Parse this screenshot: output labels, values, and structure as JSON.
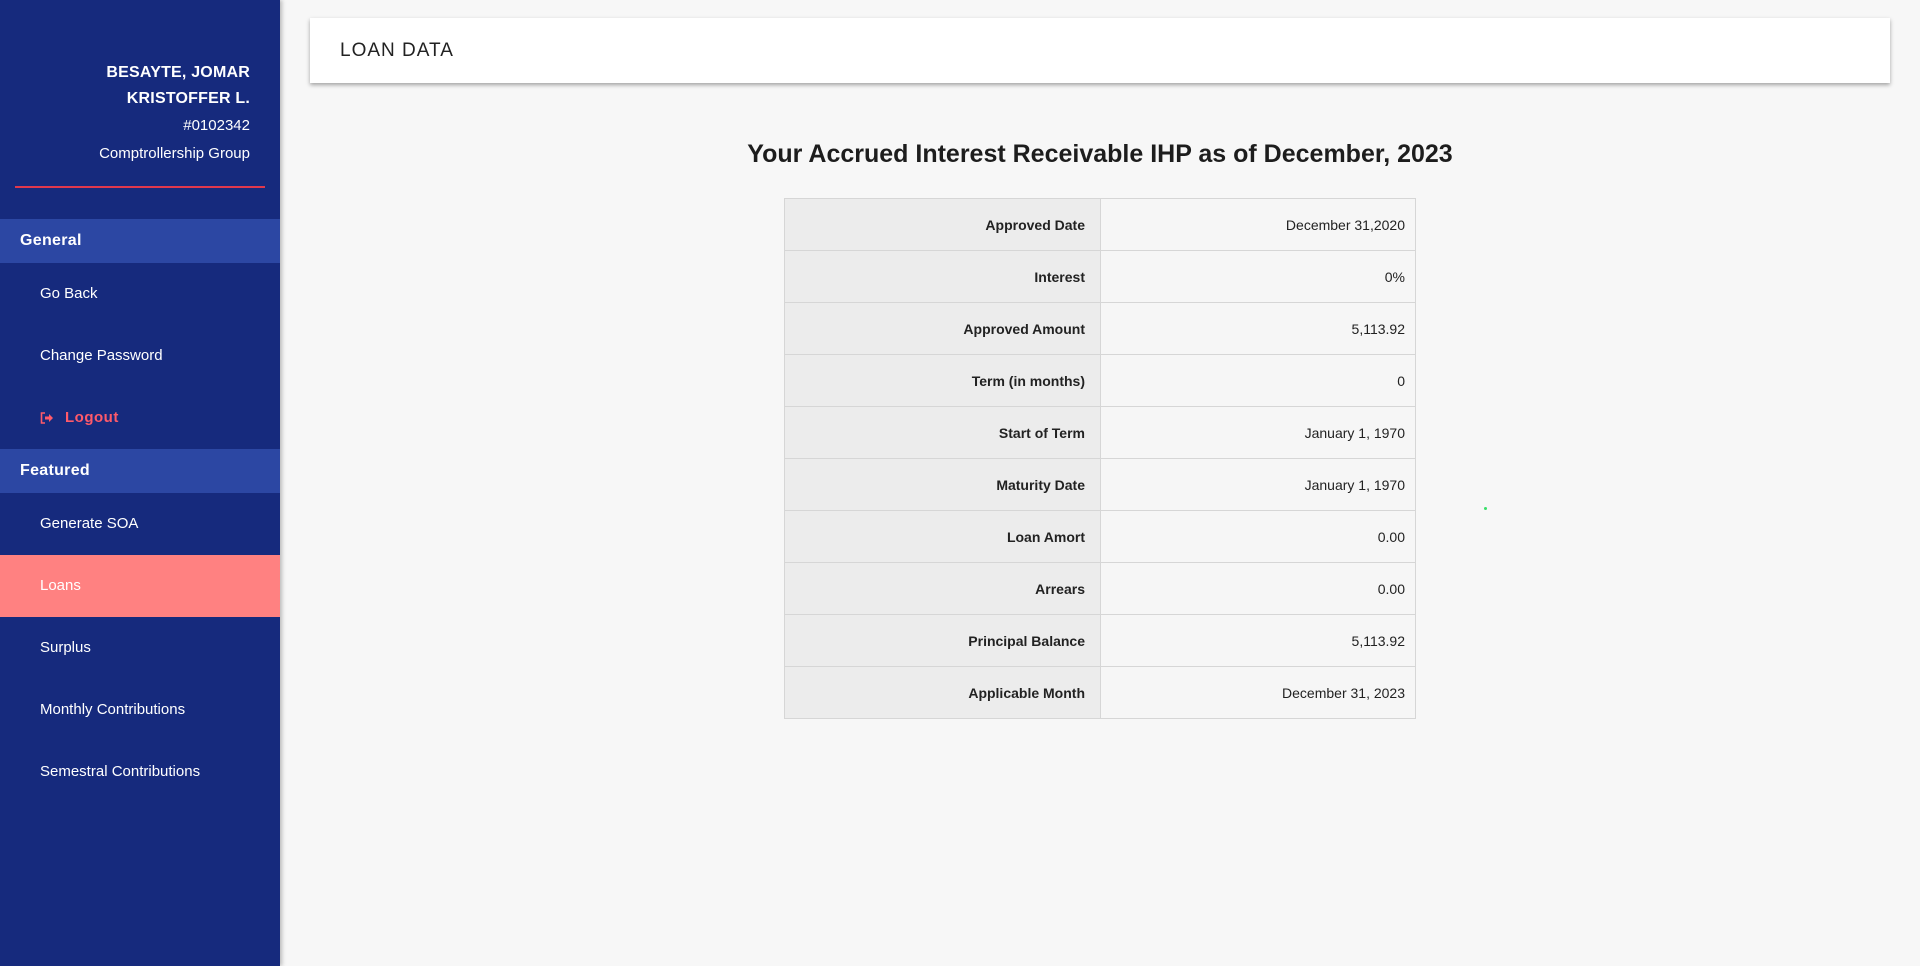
{
  "profile": {
    "name_line1": "BESAYTE, JOMAR",
    "name_line2": "KRISTOFFER L.",
    "id": "#0102342",
    "group": "Comptrollership Group"
  },
  "sidebar": {
    "general_header": "General",
    "general_items": [
      {
        "label": "Go Back"
      },
      {
        "label": "Change Password"
      },
      {
        "label": "Logout",
        "icon": "sign-out-icon"
      }
    ],
    "featured_header": "Featured",
    "featured_items": [
      {
        "label": "Generate SOA"
      },
      {
        "label": "Loans",
        "active": true
      },
      {
        "label": "Surplus"
      },
      {
        "label": "Monthly Contributions"
      },
      {
        "label": "Semestral Contributions"
      }
    ]
  },
  "header": {
    "title": "LOAN DATA"
  },
  "content": {
    "title": "Your Accrued Interest Receivable IHP as of December, 2023",
    "rows": [
      {
        "label": "Approved Date",
        "value": "December 31,2020"
      },
      {
        "label": "Interest",
        "value": "0%"
      },
      {
        "label": "Approved Amount",
        "value": "5,113.92"
      },
      {
        "label": "Term (in months)",
        "value": "0"
      },
      {
        "label": "Start of Term",
        "value": "January 1, 1970"
      },
      {
        "label": "Maturity Date",
        "value": "January 1, 1970"
      },
      {
        "label": "Loan Amort",
        "value": "0.00"
      },
      {
        "label": "Arrears",
        "value": "0.00"
      },
      {
        "label": "Principal Balance",
        "value": "5,113.92"
      },
      {
        "label": "Applicable Month",
        "value": "December 31, 2023"
      }
    ]
  },
  "colors": {
    "sidebar_bg": "#162a7d",
    "section_header_bg": "#2c47a3",
    "active_item_bg": "#ff8181",
    "logout_text": "#ff5a6a",
    "divider": "#e0384d"
  }
}
